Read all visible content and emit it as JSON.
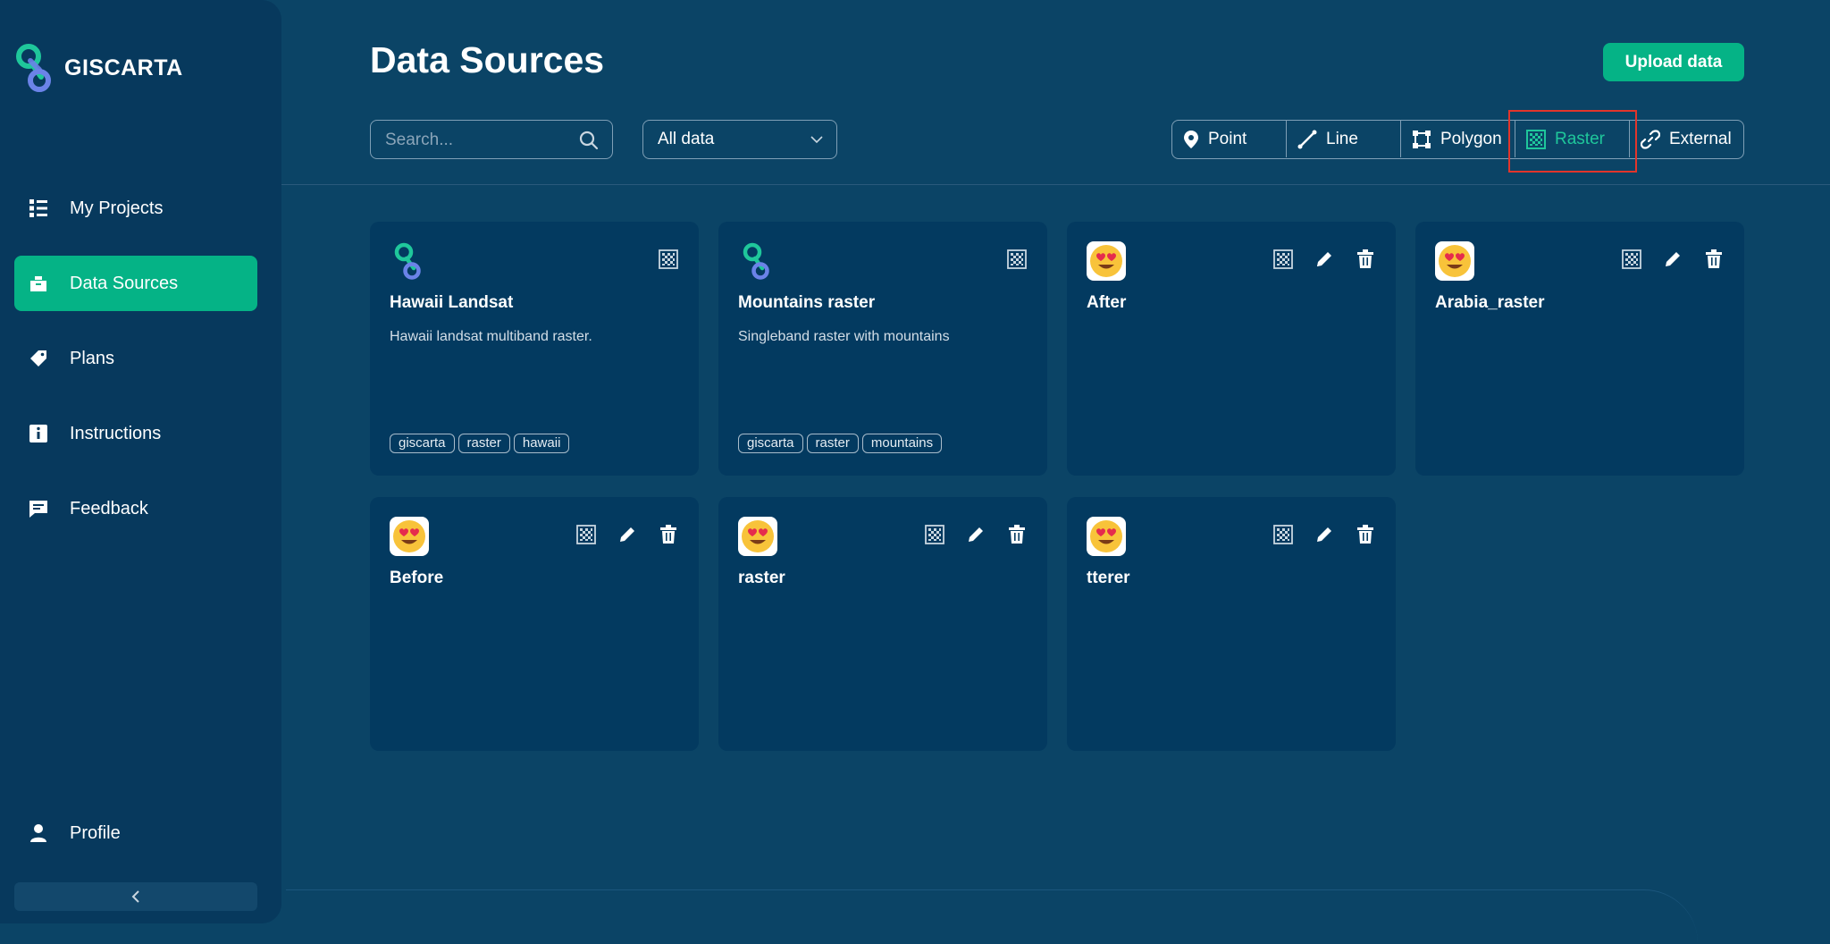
{
  "app": {
    "brand": "GISCARTA"
  },
  "sidebar": {
    "items": [
      {
        "label": "My Projects",
        "icon": "projects-icon"
      },
      {
        "label": "Data Sources",
        "icon": "data-sources-icon",
        "active": true
      },
      {
        "label": "Plans",
        "icon": "tag-icon"
      },
      {
        "label": "Instructions",
        "icon": "info-icon"
      },
      {
        "label": "Feedback",
        "icon": "feedback-icon"
      }
    ],
    "profile_label": "Profile"
  },
  "header": {
    "title": "Data Sources",
    "upload_label": "Upload data"
  },
  "toolbar": {
    "search_placeholder": "Search...",
    "select_value": "All data",
    "filters": [
      {
        "label": "Point",
        "icon": "map-pin-icon"
      },
      {
        "label": "Line",
        "icon": "line-icon"
      },
      {
        "label": "Polygon",
        "icon": "polygon-icon"
      },
      {
        "label": "Raster",
        "icon": "raster-icon",
        "active": true
      },
      {
        "label": "External",
        "icon": "link-icon"
      }
    ]
  },
  "cards": [
    {
      "title": "Hawaii Landsat",
      "description": "Hawaii landsat multiband raster.",
      "tags": [
        "giscarta",
        "raster",
        "hawaii"
      ],
      "icon": "giscarta-logo-icon",
      "editable": false
    },
    {
      "title": "Mountains raster",
      "description": "Singleband raster with mountains",
      "tags": [
        "giscarta",
        "raster",
        "mountains"
      ],
      "icon": "giscarta-logo-icon",
      "editable": false
    },
    {
      "title": "After",
      "description": "",
      "tags": [],
      "icon": "heart-eyes-emoji-icon",
      "editable": true
    },
    {
      "title": "Arabia_raster",
      "description": "",
      "tags": [],
      "icon": "heart-eyes-emoji-icon",
      "editable": true
    },
    {
      "title": "Before",
      "description": "",
      "tags": [],
      "icon": "heart-eyes-emoji-icon",
      "editable": true
    },
    {
      "title": "raster",
      "description": "",
      "tags": [],
      "icon": "heart-eyes-emoji-icon",
      "editable": true
    },
    {
      "title": "tterer",
      "description": "",
      "tags": [],
      "icon": "heart-eyes-emoji-icon",
      "editable": true
    }
  ],
  "colors": {
    "background": "#0b4466",
    "sidebar": "#07395d",
    "card": "#033a60",
    "accent": "#05b386",
    "highlight": "#e2352b"
  }
}
